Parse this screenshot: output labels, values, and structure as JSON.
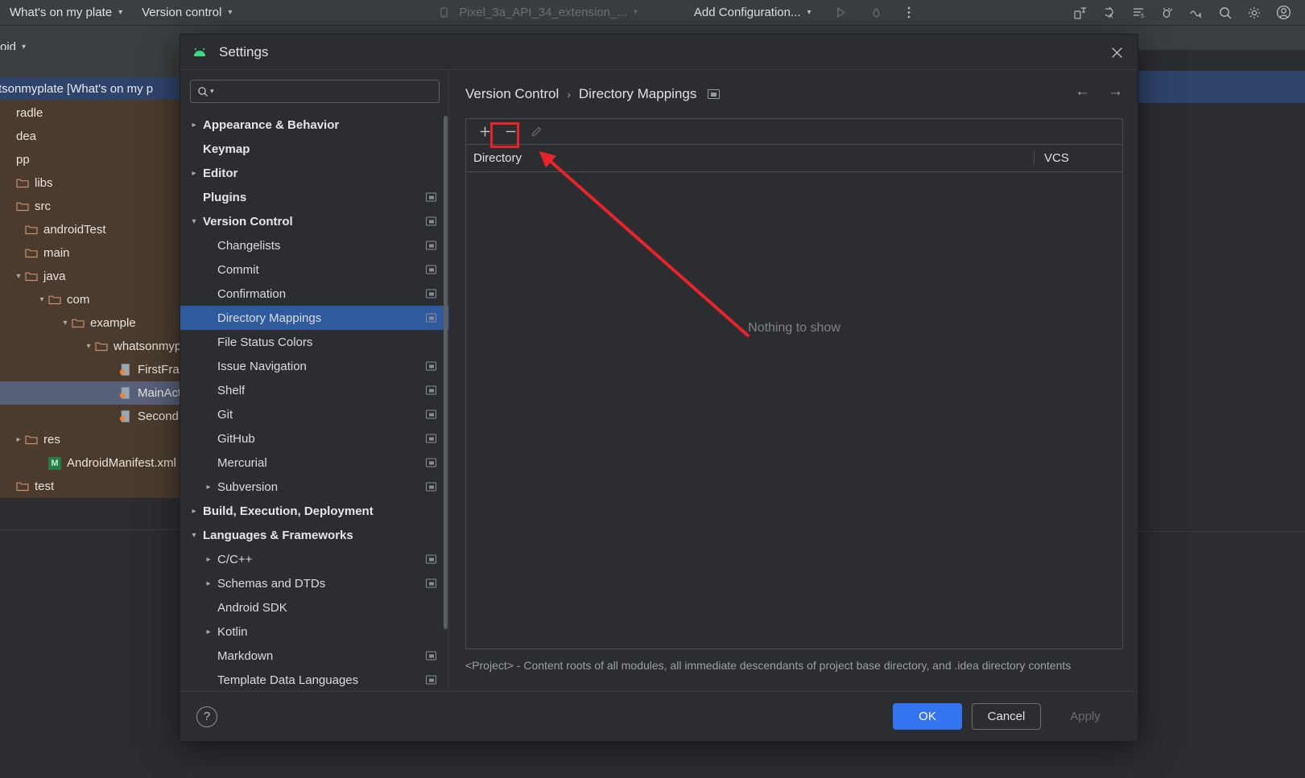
{
  "ide": {
    "topbar": {
      "project_menu": "What's on my plate",
      "vcs_menu": "Version control",
      "device": "Pixel_3a_API_34_extension_...",
      "run_config": "Add Configuration...",
      "icons": [
        "run-icon",
        "debug-icon",
        "more-vertical-icon",
        "device-manager-icon",
        "code-with-me-icon",
        "notifications-icon",
        "debugger-icon",
        "profiler-icon",
        "search-everywhere-icon",
        "settings-gear-icon",
        "account-icon"
      ]
    },
    "sidebar": {
      "scope_label": "oid",
      "project_title": "tsonmyplate [What's on my p",
      "tree": [
        {
          "label": "radle",
          "indent": 0,
          "arrow": "",
          "icon": "none"
        },
        {
          "label": "dea",
          "indent": 0,
          "arrow": "",
          "icon": "none"
        },
        {
          "label": "pp",
          "indent": 0,
          "arrow": "",
          "icon": "none"
        },
        {
          "label": "libs",
          "indent": 0,
          "arrow": "",
          "icon": "folder"
        },
        {
          "label": "src",
          "indent": 0,
          "arrow": "",
          "icon": "folder"
        },
        {
          "label": "androidTest",
          "indent": 1,
          "arrow": "",
          "icon": "folder"
        },
        {
          "label": "main",
          "indent": 1,
          "arrow": "",
          "icon": "folder"
        },
        {
          "label": "java",
          "indent": 1,
          "arrow": "v",
          "icon": "folder"
        },
        {
          "label": "com",
          "indent": 2,
          "arrow": "v",
          "icon": "folder"
        },
        {
          "label": "example",
          "indent": 3,
          "arrow": "v",
          "icon": "folder"
        },
        {
          "label": "whatsonmypl",
          "indent": 4,
          "arrow": "v",
          "icon": "folder"
        },
        {
          "label": "FirstFragn",
          "indent": 5,
          "arrow": "",
          "icon": "java"
        },
        {
          "label": "MainActiv",
          "indent": 5,
          "arrow": "",
          "icon": "java",
          "selected": true
        },
        {
          "label": "SecondFra",
          "indent": 5,
          "arrow": "",
          "icon": "java"
        },
        {
          "label": "res",
          "indent": 1,
          "arrow": ">",
          "icon": "folder"
        },
        {
          "label": "AndroidManifest.xml",
          "indent": 2,
          "arrow": "",
          "icon": "xml"
        },
        {
          "label": "test",
          "indent": 0,
          "arrow": "",
          "icon": "folder"
        }
      ]
    }
  },
  "dialog": {
    "title": "Settings",
    "logo_icon": "android-studio-icon",
    "close_icon": "close-icon",
    "search": {
      "value": "",
      "placeholder": "",
      "icon": "search-icon"
    },
    "settings_tree": [
      {
        "label": "Appearance & Behavior",
        "level": 0,
        "arrow": ">",
        "bold": true,
        "badge": false
      },
      {
        "label": "Keymap",
        "level": 0,
        "arrow": "",
        "bold": true,
        "badge": false
      },
      {
        "label": "Editor",
        "level": 0,
        "arrow": ">",
        "bold": true,
        "badge": false
      },
      {
        "label": "Plugins",
        "level": 0,
        "arrow": "",
        "bold": true,
        "badge": true
      },
      {
        "label": "Version Control",
        "level": 0,
        "arrow": "v",
        "bold": true,
        "badge": true
      },
      {
        "label": "Changelists",
        "level": 1,
        "arrow": "",
        "bold": false,
        "badge": true
      },
      {
        "label": "Commit",
        "level": 1,
        "arrow": "",
        "bold": false,
        "badge": true
      },
      {
        "label": "Confirmation",
        "level": 1,
        "arrow": "",
        "bold": false,
        "badge": true
      },
      {
        "label": "Directory Mappings",
        "level": 1,
        "arrow": "",
        "bold": false,
        "badge": true,
        "selected": true
      },
      {
        "label": "File Status Colors",
        "level": 1,
        "arrow": "",
        "bold": false,
        "badge": false
      },
      {
        "label": "Issue Navigation",
        "level": 1,
        "arrow": "",
        "bold": false,
        "badge": true
      },
      {
        "label": "Shelf",
        "level": 1,
        "arrow": "",
        "bold": false,
        "badge": true
      },
      {
        "label": "Git",
        "level": 1,
        "arrow": "",
        "bold": false,
        "badge": true
      },
      {
        "label": "GitHub",
        "level": 1,
        "arrow": "",
        "bold": false,
        "badge": true
      },
      {
        "label": "Mercurial",
        "level": 1,
        "arrow": "",
        "bold": false,
        "badge": true
      },
      {
        "label": "Subversion",
        "level": 1,
        "arrow": ">",
        "bold": false,
        "badge": true
      },
      {
        "label": "Build, Execution, Deployment",
        "level": 0,
        "arrow": ">",
        "bold": true,
        "badge": false
      },
      {
        "label": "Languages & Frameworks",
        "level": 0,
        "arrow": "v",
        "bold": true,
        "badge": false
      },
      {
        "label": "C/C++",
        "level": 1,
        "arrow": ">",
        "bold": false,
        "badge": true
      },
      {
        "label": "Schemas and DTDs",
        "level": 1,
        "arrow": ">",
        "bold": false,
        "badge": true
      },
      {
        "label": "Android SDK",
        "level": 1,
        "arrow": "",
        "bold": false,
        "badge": false
      },
      {
        "label": "Kotlin",
        "level": 1,
        "arrow": ">",
        "bold": false,
        "badge": false
      },
      {
        "label": "Markdown",
        "level": 1,
        "arrow": "",
        "bold": false,
        "badge": true
      },
      {
        "label": "Template Data Languages",
        "level": 1,
        "arrow": "",
        "bold": false,
        "badge": true
      }
    ],
    "breadcrumb": {
      "root": "Version Control",
      "separator": "›",
      "current": "Directory Mappings",
      "badge_icon": "project-scope-icon",
      "back_icon": "←",
      "forward_icon": "→"
    },
    "table": {
      "toolbar": {
        "add_label": "+",
        "remove_label": "—",
        "edit_icon": "pencil-icon"
      },
      "columns": [
        "Directory",
        "VCS"
      ],
      "rows": [],
      "empty_message": "Nothing to show"
    },
    "hint": "<Project> - Content roots of all modules, all immediate descendants of project base directory, and .idea directory contents",
    "footer": {
      "help_label": "?",
      "ok_label": "OK",
      "cancel_label": "Cancel",
      "apply_label": "Apply"
    }
  },
  "annotation": {
    "highlight_color": "#e8232a",
    "target": "remove-mapping-button"
  }
}
